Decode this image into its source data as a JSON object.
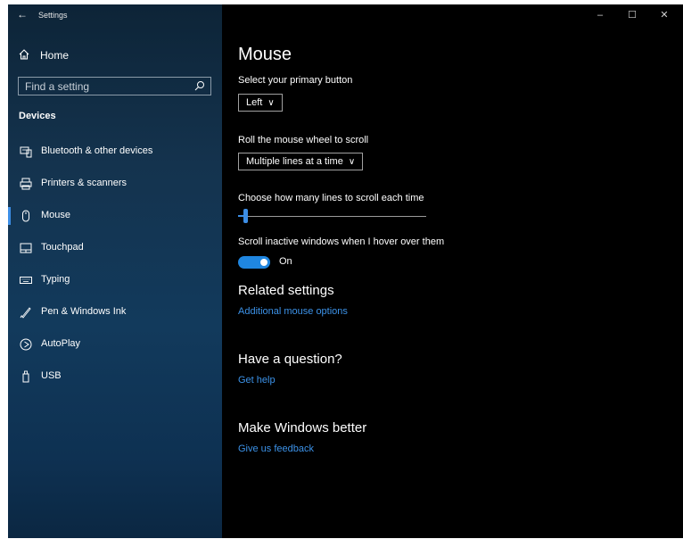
{
  "titlebar": {
    "app_title": "Settings",
    "back_icon": "back-arrow-icon"
  },
  "window_controls": {
    "minimize": "–",
    "maximize": "☐",
    "close": "✕"
  },
  "sidebar": {
    "home_label": "Home",
    "search_placeholder": "Find a setting",
    "section_label": "Devices",
    "items": [
      {
        "label": "Bluetooth & other devices",
        "icon": "bluetooth-devices-icon"
      },
      {
        "label": "Printers & scanners",
        "icon": "printer-icon"
      },
      {
        "label": "Mouse",
        "icon": "mouse-icon",
        "selected": true
      },
      {
        "label": "Touchpad",
        "icon": "touchpad-icon"
      },
      {
        "label": "Typing",
        "icon": "keyboard-icon"
      },
      {
        "label": "Pen & Windows Ink",
        "icon": "pen-icon"
      },
      {
        "label": "AutoPlay",
        "icon": "autoplay-icon"
      },
      {
        "label": "USB",
        "icon": "usb-icon"
      }
    ]
  },
  "main": {
    "title": "Mouse",
    "primary_button": {
      "label": "Select your primary button",
      "value": "Left"
    },
    "scroll": {
      "label": "Roll the mouse wheel to scroll",
      "value": "Multiple lines at a time"
    },
    "lines": {
      "label": "Choose how many lines to scroll each time",
      "fraction": 0.03
    },
    "inactive": {
      "label": "Scroll inactive windows when I hover over them",
      "state": "On"
    },
    "related": {
      "heading": "Related settings",
      "link": "Additional mouse options"
    },
    "question": {
      "heading": "Have a question?",
      "link": "Get help"
    },
    "better": {
      "heading": "Make Windows better",
      "link": "Give us feedback"
    }
  },
  "colors": {
    "accent": "#1f86e0",
    "link": "#3c92e8",
    "background": "#000000"
  }
}
